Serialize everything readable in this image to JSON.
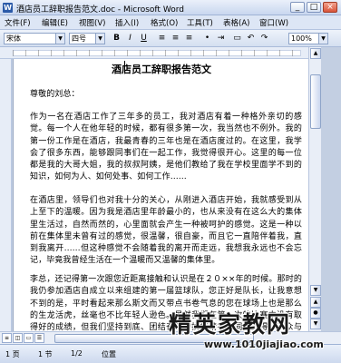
{
  "window": {
    "title": "酒店员工辞职报告范文.doc - Microsoft Word",
    "min_label": "_",
    "max_label": "□",
    "close_label": "×"
  },
  "menu": {
    "items": [
      "文件(F)",
      "编辑(E)",
      "视图(V)",
      "插入(I)",
      "格式(O)",
      "工具(T)",
      "表格(A)",
      "窗口(W)"
    ]
  },
  "toolbar": {
    "font_name": "宋体",
    "font_size": "四号",
    "zoom": "100%",
    "bold": "B",
    "italic": "I",
    "underline": "U"
  },
  "document": {
    "title": "酒店员工辞职报告范文",
    "salutation": "尊敬的刘总：",
    "paragraphs": [
      "作为一名在酒店工作了三年多的员工，我对酒店有着一种格外亲切的感觉。每一个人在他年轻的时候，都有很多第一次，我当然也不例外。我的第一份工作是在酒店，我最青春的三年也是在酒店度过的。在这里，我学会了很多东西，能够跟同事们在一起工作，我觉得很开心。这里的每一位都是我的大哥大姐，我的叔叔阿姨，是他们教给了我在学校里面学不到的知识，如何为人、如何处事、如何工作……",
      "在酒店里，领导们也对我十分的关心，从刚进入酒店开始，我就感受到从上至下的温暖。因为我是酒店里年龄最小的，也从来没有在这么大的集体里生活过，自然而然的，心里面就会产生一种被呵护的感觉。这是一种以前在集体里未曾有过的感觉，很温馨，很自豪，而且它一直陪伴着我，直到我离开……但这种感觉不会随着我的离开而走远，我想我永远也不会忘记，毕竟我曾经生活在一个温暖而又温馨的集体里。",
      "李总，还记得第一次跟您近距离接触和认识是在２０××年的时候。那时的我仍参加酒店自成立以来组建的第一届篮球队，您正好是队长，让我意想不到的是，平时看起来那么斯文而又带点书卷气息的您在球场上也是那么的生龙活虎，丝毫也不比年轻人逊色。虽然我们在第一次的比赛中没有取得好的成绩，但我们坚持到底、团结奋斗的拼搏精神，同样赢得了观众与裁判的认可，最后获得了体育道德风尚奖的称号。这是您带领我们取得的第一个集体荣誉……"
    ]
  },
  "status": {
    "page": "1 页",
    "section": "1 节",
    "page_count": "1/2",
    "position": "位置"
  },
  "watermark": {
    "main": "精英家教网",
    "url": "www.1010jiajiao.com"
  }
}
